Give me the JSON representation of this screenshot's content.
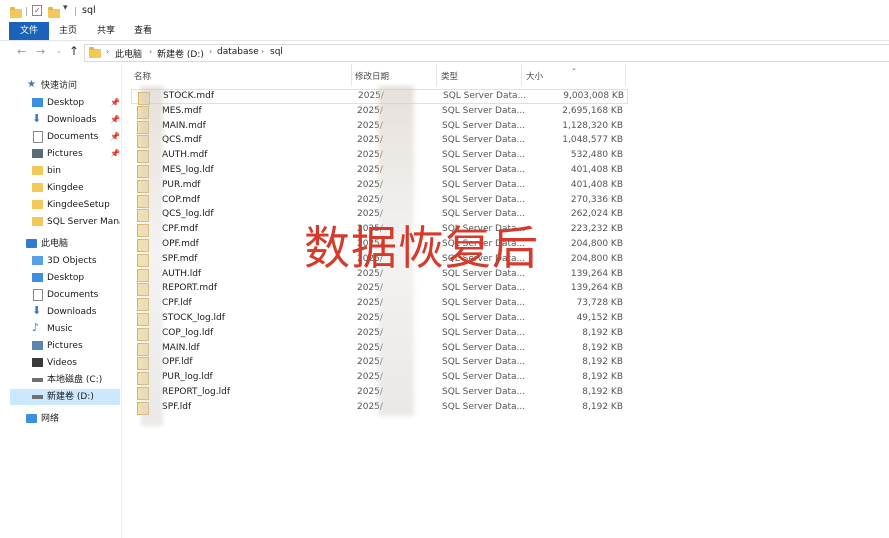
{
  "window": {
    "title": "sql"
  },
  "ribbon": {
    "tabs": [
      "文件",
      "主页",
      "共享",
      "查看"
    ]
  },
  "address": {
    "crumbs": [
      "此电脑",
      "新建卷 (D:)",
      "database",
      "sql"
    ]
  },
  "sidebar": {
    "quick_access_label": "快速访问",
    "quick_items": [
      "Desktop",
      "Downloads",
      "Documents",
      "Pictures",
      "bin",
      "Kingdee",
      "KingdeeSetup",
      "SQL Server Mana"
    ],
    "this_pc_label": "此电脑",
    "pc_items": [
      "3D Objects",
      "Desktop",
      "Documents",
      "Downloads",
      "Music",
      "Pictures",
      "Videos",
      "本地磁盘 (C:)",
      "新建卷 (D:)"
    ],
    "network_label": "网络"
  },
  "columns": {
    "name": "名称",
    "date": "修改日期",
    "type": "类型",
    "size": "大小"
  },
  "files": [
    {
      "name": "STOCK.mdf",
      "date": "2025/",
      "type": "SQL Server Data...",
      "size": "9,003,008 KB"
    },
    {
      "name": "MES.mdf",
      "date": "2025/",
      "type": "SQL Server Data...",
      "size": "2,695,168 KB"
    },
    {
      "name": "MAIN.mdf",
      "date": "2025/",
      "type": "SQL Server Data...",
      "size": "1,128,320 KB"
    },
    {
      "name": "QCS.mdf",
      "date": "2025/",
      "type": "SQL Server Data...",
      "size": "1,048,577 KB"
    },
    {
      "name": "AUTH.mdf",
      "date": "2025/",
      "type": "SQL Server Data...",
      "size": "532,480 KB"
    },
    {
      "name": "MES_log.ldf",
      "date": "2025/",
      "type": "SQL Server Data...",
      "size": "401,408 KB"
    },
    {
      "name": "PUR.mdf",
      "date": "2025/",
      "type": "SQL Server Data...",
      "size": "401,408 KB"
    },
    {
      "name": "COP.mdf",
      "date": "2025/",
      "type": "SQL Server Data...",
      "size": "270,336 KB"
    },
    {
      "name": "QCS_log.ldf",
      "date": "2025/",
      "type": "SQL Server Data...",
      "size": "262,024 KB"
    },
    {
      "name": "CPF.mdf",
      "date": "2025/",
      "type": "SQL Server Data...",
      "size": "223,232 KB"
    },
    {
      "name": "OPF.mdf",
      "date": "2025/",
      "type": "SQL Server Data...",
      "size": "204,800 KB"
    },
    {
      "name": "SPF.mdf",
      "date": "2025/",
      "type": "SQL Server Data...",
      "size": "204,800 KB"
    },
    {
      "name": "AUTH.ldf",
      "date": "2025/",
      "type": "SQL Server Data...",
      "size": "139,264 KB"
    },
    {
      "name": "REPORT.mdf",
      "date": "2025/",
      "type": "SQL Server Data...",
      "size": "139,264 KB"
    },
    {
      "name": "CPF.ldf",
      "date": "2025/",
      "type": "SQL Server Data...",
      "size": "73,728 KB"
    },
    {
      "name": "STOCK_log.ldf",
      "date": "2025/",
      "type": "SQL Server Data...",
      "size": "49,152 KB"
    },
    {
      "name": "COP_log.ldf",
      "date": "2025/",
      "type": "SQL Server Data...",
      "size": "8,192 KB"
    },
    {
      "name": "MAIN.ldf",
      "date": "2025/",
      "type": "SQL Server Data...",
      "size": "8,192 KB"
    },
    {
      "name": "OPF.ldf",
      "date": "2025/",
      "type": "SQL Server Data...",
      "size": "8,192 KB"
    },
    {
      "name": "PUR_log.ldf",
      "date": "2025/",
      "type": "SQL Server Data...",
      "size": "8,192 KB"
    },
    {
      "name": "REPORT_log.ldf",
      "date": "2025/",
      "type": "SQL Server Data...",
      "size": "8,192 KB"
    },
    {
      "name": "SPF.ldf",
      "date": "2025/",
      "type": "SQL Server Data...",
      "size": "8,192 KB"
    }
  ],
  "overlay_text": "数据恢复后"
}
